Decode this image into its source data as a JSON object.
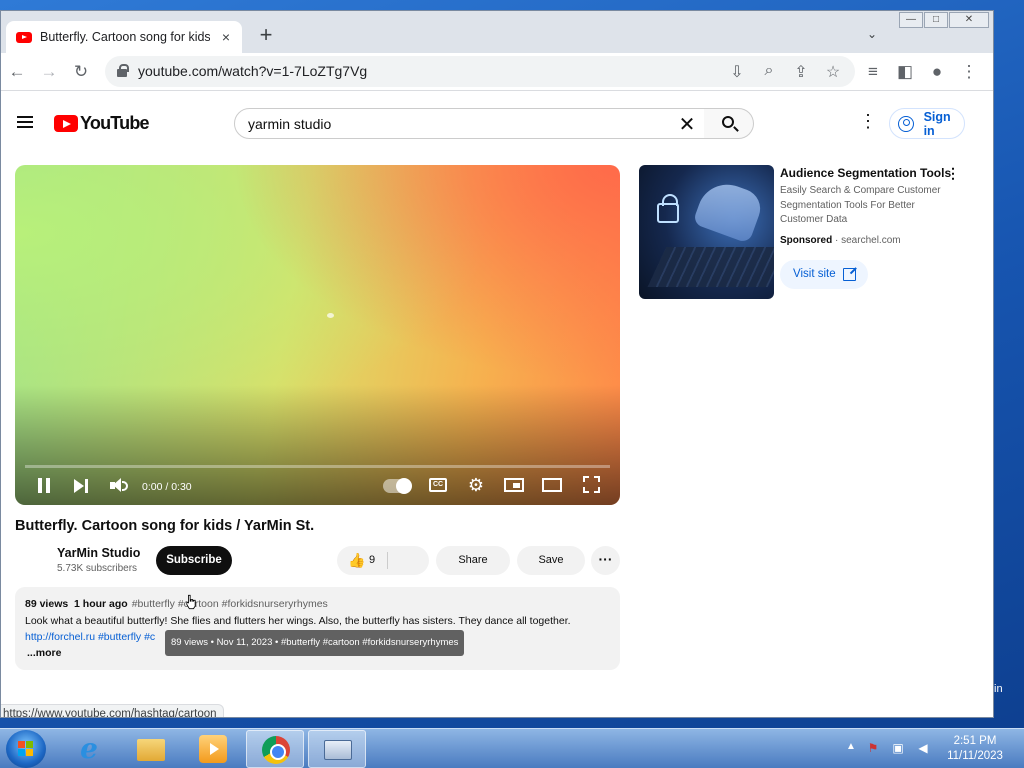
{
  "browser": {
    "tab": {
      "title": "Butterfly. Cartoon song for kids / YarMin St.",
      "close": "×"
    },
    "new_tab": "+",
    "tab_list": "⌄",
    "window_controls": {
      "minimize": "—",
      "maximize": "□",
      "close": "✕"
    },
    "nav": {
      "back": "←",
      "forward": "→",
      "reload": "↻"
    },
    "url": "youtube.com/watch?v=1-7LoZTg7Vg",
    "omnibox_actions": [
      "install-icon",
      "zoom-icon",
      "share-icon",
      "bookmark-star-icon"
    ],
    "toolbar_right": [
      "reading-list-icon",
      "side-panel-icon",
      "profile-icon",
      "menu-icon"
    ],
    "status_url": "https://www.youtube.com/hashtag/cartoon"
  },
  "youtube": {
    "logo_text": "YouTube",
    "search": {
      "value": "yarmin studio",
      "clear": "✕"
    },
    "sign_in": "Sign in",
    "player": {
      "time": "0:00 / 0:30",
      "cc": "CC",
      "progress_fraction": 0
    },
    "video": {
      "title": "Butterfly. Cartoon song for kids / YarMin St.",
      "channel": "YarMin Studio",
      "subscribers": "5.73K subscribers",
      "subscribe": "Subscribe",
      "likes": "9",
      "share": "Share",
      "save": "Save",
      "more": "···"
    },
    "description": {
      "views": "89 views",
      "age": "1 hour ago",
      "tags": "#butterfly #cartoon #forkidsnurseryrhymes",
      "body": "Look what a beautiful butterfly! She flies and flutters her wings. Also, the butterfly has sisters. They dance all together.",
      "link1": "http://forchel.ru",
      "link2": "#butterfly",
      "link3": "#c",
      "more": "...more",
      "tooltip": "89 views • Nov 11, 2023 • #butterfly #cartoon #forkidsnurseryrhymes"
    },
    "ad": {
      "title": "Audience Segmentation Tools",
      "description": "Easily Search & Compare Customer Segmentation Tools For Better Customer Data",
      "sponsored": "Sponsored",
      "domain": "searchel.com",
      "visit": "Visit site"
    }
  },
  "desktop": {
    "side_text": "in",
    "taskbar_apps": [
      "internet-explorer-icon",
      "file-explorer-icon",
      "media-player-icon",
      "chrome-icon",
      "keyboard-icon"
    ],
    "clock": {
      "time": "2:51 PM",
      "date": "11/11/2023"
    }
  }
}
